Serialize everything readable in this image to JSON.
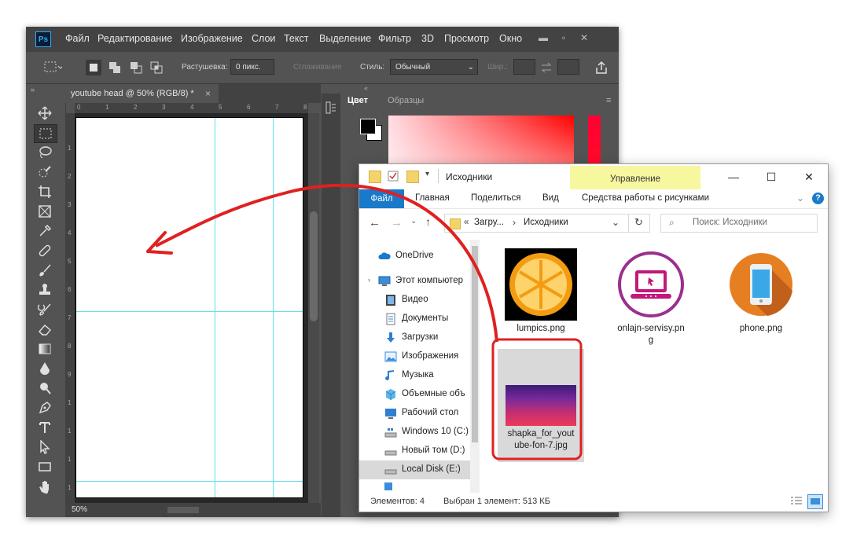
{
  "photoshop": {
    "logo": "Ps",
    "menu": [
      "Файл",
      "Редактирование",
      "Изображение",
      "Слои",
      "Текст",
      "Выделение",
      "Фильтр",
      "3D",
      "Просмотр",
      "Окно"
    ],
    "options": {
      "feather_label": "Растушевка:",
      "feather_value": "0 пикс.",
      "antialias_label": "Сглаживание",
      "style_label": "Стиль:",
      "style_value": "Обычный",
      "width_label": "Шир.:"
    },
    "document_tab": "youtube head @ 50% (RGB/8) *",
    "document_tab_close": "×",
    "zoom": "50%",
    "ruler_top": [
      "0",
      "1",
      "2",
      "3",
      "4",
      "5",
      "6",
      "7",
      "8"
    ],
    "ruler_left": [
      "1",
      "2",
      "3",
      "4",
      "5",
      "6",
      "7",
      "8",
      "9",
      "1",
      "1",
      "1",
      "1"
    ],
    "panels": {
      "tabs": [
        "Цвет",
        "Образцы"
      ]
    }
  },
  "explorer": {
    "title": "Исходники",
    "manage_label": "Управление",
    "ribbon": {
      "file_tab": "Файл",
      "tabs": [
        "Главная",
        "Поделиться",
        "Вид",
        "Средства работы с рисунками"
      ]
    },
    "address": {
      "prefix": "«",
      "parts": [
        "Загру...",
        "›",
        "Исходники"
      ]
    },
    "search_placeholder": "Поиск: Исходники",
    "nav": [
      {
        "label": "OneDrive",
        "icon": "cloud-icon"
      },
      {
        "label": "Этот компьютер",
        "icon": "computer-icon"
      },
      {
        "label": "Видео",
        "icon": "video-icon"
      },
      {
        "label": "Документы",
        "icon": "documents-icon"
      },
      {
        "label": "Загрузки",
        "icon": "download-icon"
      },
      {
        "label": "Изображения",
        "icon": "pictures-icon"
      },
      {
        "label": "Музыка",
        "icon": "music-icon"
      },
      {
        "label": "Объемные объ",
        "icon": "cube-icon"
      },
      {
        "label": "Рабочий стол",
        "icon": "desktop-icon"
      },
      {
        "label": "Windows 10 (C:)",
        "icon": "windows-drive-icon"
      },
      {
        "label": "Новый том (D:)",
        "icon": "drive-icon"
      },
      {
        "label": "Local Disk (E:)",
        "icon": "drive-icon"
      }
    ],
    "files": [
      {
        "line1": "lumpics.png",
        "line2": ""
      },
      {
        "line1": "onlajn-servisy.pn",
        "line2": "g"
      },
      {
        "line1": "phone.png",
        "line2": ""
      },
      {
        "line1": "shapka_for_yout",
        "line2": "ube-fon-7.jpg"
      }
    ],
    "status": {
      "count": "Элементов: 4",
      "selection": "Выбран 1 элемент: 513 КБ"
    },
    "controls": {
      "minimize": "—",
      "maximize": "☐",
      "close": "✕"
    },
    "help": "?"
  },
  "colors": {
    "ps_dark": "#434343",
    "ps_mid": "#535353",
    "guide": "#5fe0ea",
    "accent_blue": "#1979ca",
    "manage_yellow": "#f7f7a0",
    "arrow_red": "#e02020",
    "selection_gray": "#d9d9d9"
  }
}
